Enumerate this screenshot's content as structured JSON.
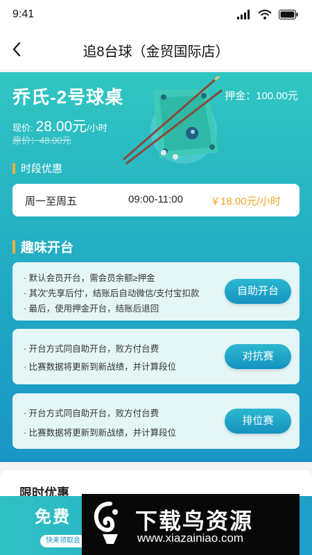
{
  "status_bar": {
    "time": "9:41"
  },
  "nav": {
    "title": "追8台球（金贸国际店）"
  },
  "table": {
    "name": "乔氏-2号球桌",
    "deposit": "押金：100.00元",
    "price_label": "现价:",
    "price_value": "28.00元",
    "price_unit": "/小时",
    "original_price": "原价：48.00元"
  },
  "time_discount": {
    "title": "时段优惠",
    "days": "周一至周五",
    "hours": "09:00-11:00",
    "price": "￥18.00元/小时"
  },
  "fun_start": {
    "title": "趣味开台",
    "cards": [
      {
        "lines": [
          "· 默认会员开台，需会员余额≥押金",
          "· 其次'先享后付'，结账后自动微信/支付宝扣款",
          "· 最后，使用押金开台，结账后退回"
        ],
        "button": "自助开台"
      },
      {
        "lines": [
          "· 开台方式同自助开台，败方付台费",
          "· 比赛数据将更新到新战绩，并计算段位"
        ],
        "button": "对抗赛"
      },
      {
        "lines": [
          "· 开台方式同自助开台，败方付台费",
          "· 比赛数据将更新到新战绩，并计算段位"
        ],
        "button": "排位赛"
      }
    ]
  },
  "promo": {
    "title": "限时优惠",
    "slogan": "免费",
    "pill": "快来领取会"
  },
  "watermark": {
    "text": "下载鸟资源",
    "url": "www.xiazainiao.com"
  },
  "colors": {
    "accent": "#f5a623",
    "teal": "#27b6c4",
    "button": "#1a96c6"
  }
}
